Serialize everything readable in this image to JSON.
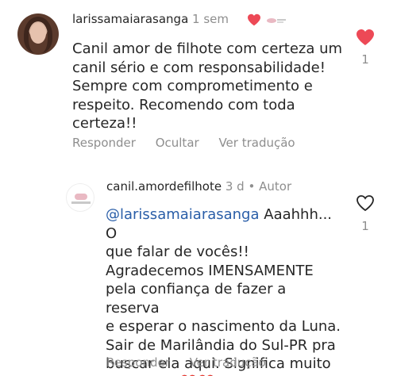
{
  "comments": [
    {
      "username": "larissamaiarasanga",
      "time": "1 sem",
      "text": "Canil amor de filhote com certeza um\ncanil sério e com responsabilidade!\nSempre com comprometimento e\nrespeito. Recomendo com toda\ncerteza!!",
      "like_count": "1",
      "actions": [
        "Responder",
        "Ocultar",
        "Ver tradução"
      ],
      "liked": true
    },
    {
      "username": "canil.amordefilhote",
      "time": "3 d",
      "separator": "•",
      "author_badge": "Autor",
      "mention": "@larissamaiarasanga",
      "text": " Aaahhh... O\nque falar de vocês!!\nAgradecemos IMENSAMENTE\npela confiança de fazer a reserva\ne esperar o  nascimento da Luna.\nSair de Marilândia do Sul-PR  pra\nbuscar ela aqui. Significa muito\npra gente ❤️❤️",
      "like_count": "1",
      "actions": [
        "Responder",
        "Ver tradução"
      ],
      "liked": false
    }
  ],
  "colors": {
    "text": "#262626",
    "secondary": "#8e8e8e",
    "mention": "#2a5ea8",
    "heart": "#ed4956"
  },
  "icons": {
    "like_filled": "heart-filled-icon",
    "like_outline": "heart-outline-icon",
    "creator_liked": "heart-filled-icon"
  }
}
